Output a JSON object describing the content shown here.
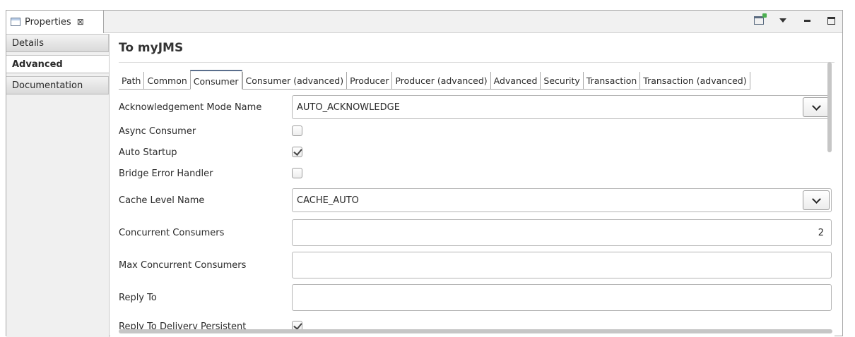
{
  "view": {
    "tab_label": "Properties",
    "close_glyph": "⊠"
  },
  "sidebar": {
    "items": [
      {
        "label": "Details",
        "active": false
      },
      {
        "label": "Advanced",
        "active": true
      },
      {
        "label": "Documentation",
        "active": false
      }
    ]
  },
  "main": {
    "title": "To myJMS",
    "tabs": [
      {
        "label": "Path"
      },
      {
        "label": "Common"
      },
      {
        "label": "Consumer"
      },
      {
        "label": "Consumer (advanced)"
      },
      {
        "label": "Producer"
      },
      {
        "label": "Producer (advanced)"
      },
      {
        "label": "Advanced"
      },
      {
        "label": "Security"
      },
      {
        "label": "Transaction"
      },
      {
        "label": "Transaction (advanced)"
      }
    ],
    "active_tab": "Consumer"
  },
  "form": {
    "ack_mode_label": "Acknowledgement Mode Name",
    "ack_mode_value": "AUTO_ACKNOWLEDGE",
    "async_consumer_label": "Async Consumer",
    "async_consumer_checked": false,
    "auto_startup_label": "Auto Startup",
    "auto_startup_checked": true,
    "bridge_error_label": "Bridge Error Handler",
    "bridge_error_checked": false,
    "cache_level_label": "Cache Level Name",
    "cache_level_value": "CACHE_AUTO",
    "concurrent_label": "Concurrent Consumers",
    "concurrent_value": "2",
    "max_concurrent_label": "Max Concurrent Consumers",
    "max_concurrent_value": "",
    "reply_to_label": "Reply To",
    "reply_to_value": "",
    "reply_persistent_label": "Reply To Delivery Persistent",
    "reply_persistent_checked": true
  },
  "icons": {
    "toolbar": [
      "pin-to-view-icon",
      "view-menu-icon",
      "minimize-icon",
      "maximize-icon"
    ]
  }
}
